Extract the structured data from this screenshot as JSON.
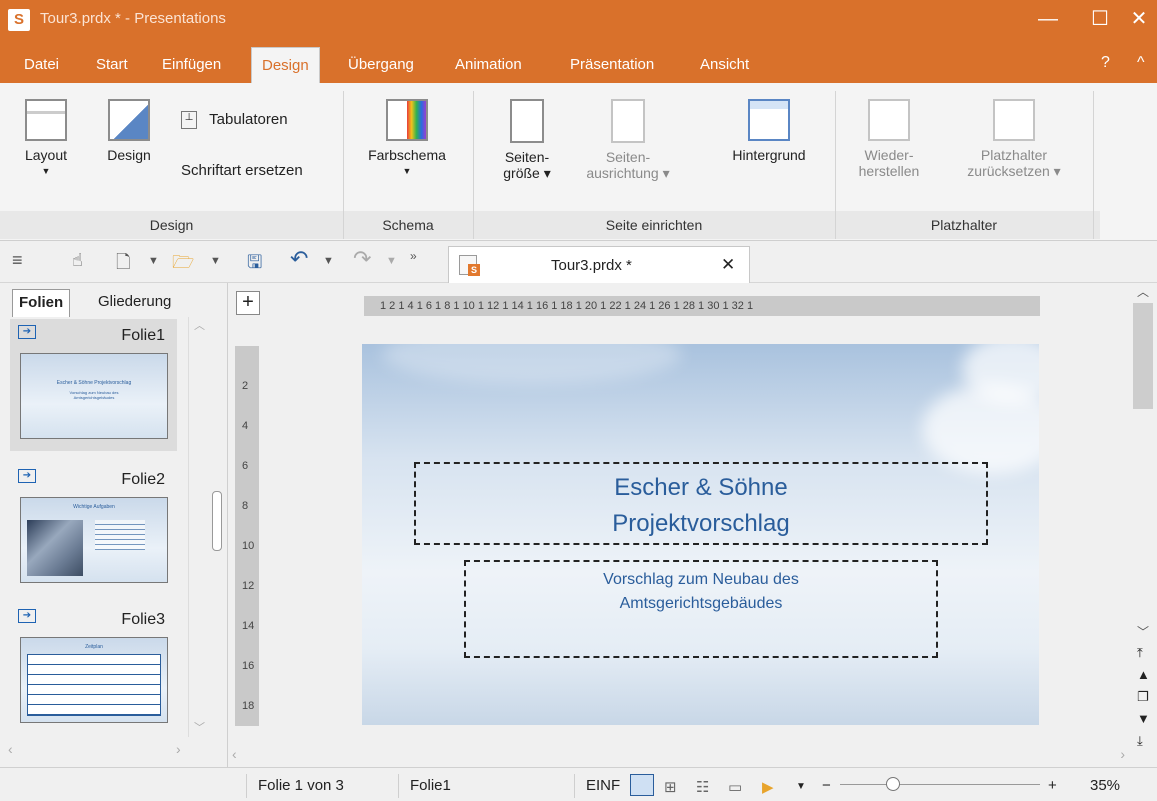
{
  "titlebar": {
    "logo": "S",
    "title": "Tour3.prdx * - Presentations",
    "minimize": "—",
    "maximize": "☐",
    "close": "✕"
  },
  "menu": {
    "tabs": [
      "Datei",
      "Start",
      "Einfügen",
      "Design",
      "Übergang",
      "Animation",
      "Präsentation",
      "Ansicht"
    ],
    "active": "Design",
    "help": "?",
    "collapse": "^"
  },
  "ribbon": {
    "groups": [
      "Design",
      "Schema",
      "Seite einrichten",
      "Platzhalter"
    ],
    "buttons": {
      "layout": "Layout",
      "design": "Design",
      "tabulatoren": "Tabulatoren",
      "schriftart": "Schriftart ersetzen",
      "farbschema": "Farbschema",
      "seitengroesse_1": "Seiten-",
      "seitengroesse_2": "größe",
      "seitenausrichtung_1": "Seiten-",
      "seitenausrichtung_2": "ausrichtung",
      "hintergrund": "Hintergrund",
      "wiederherstellen_1": "Wieder-",
      "wiederherstellen_2": "herstellen",
      "platzhalter_1": "Platzhalter",
      "platzhalter_2": "zurücksetzen"
    }
  },
  "document_tab": {
    "title": "Tour3.prdx *",
    "close": "✕",
    "icon_letter": "S"
  },
  "sidepanel": {
    "tabs": [
      "Folien",
      "Gliederung"
    ],
    "active_tab": "Folien",
    "slides": [
      {
        "label": "Folie1",
        "thumb_title": "Escher & Söhne Projektvorschlag",
        "thumb_sub": "Vorschlag zum Neubau des Amtsgerichtsgebäudes"
      },
      {
        "label": "Folie2",
        "thumb_title": "Wichtige Aufgaben"
      },
      {
        "label": "Folie3",
        "thumb_title": "Zeitplan"
      }
    ]
  },
  "ruler": {
    "horizontal": "1 2 1 4 1 6 1 8 1 10 1 12 1 14 1 16 1 18 1 20 1 22 1 24 1 26 1 28 1 30 1 32 1",
    "vertical": [
      "2",
      "4",
      "6",
      "8",
      "10",
      "12",
      "14",
      "16",
      "18"
    ]
  },
  "slide": {
    "title_line1": "Escher & Söhne",
    "title_line2": "Projektvorschlag",
    "sub_line1": "Vorschlag zum Neubau des",
    "sub_line2": "Amtsgerichtsgebäudes"
  },
  "statusbar": {
    "page": "Folie 1 von 3",
    "slide_name": "Folie1",
    "mode": "EINF",
    "zoom": "35%",
    "zoom_minus": "−",
    "zoom_plus": "+"
  },
  "colors": {
    "accent": "#d9712b",
    "slide_text": "#2a5d9b"
  },
  "icons": [
    "hamburger-icon",
    "hand-icon",
    "new-document-icon",
    "open-folder-icon",
    "save-icon",
    "undo-icon",
    "redo-icon"
  ]
}
